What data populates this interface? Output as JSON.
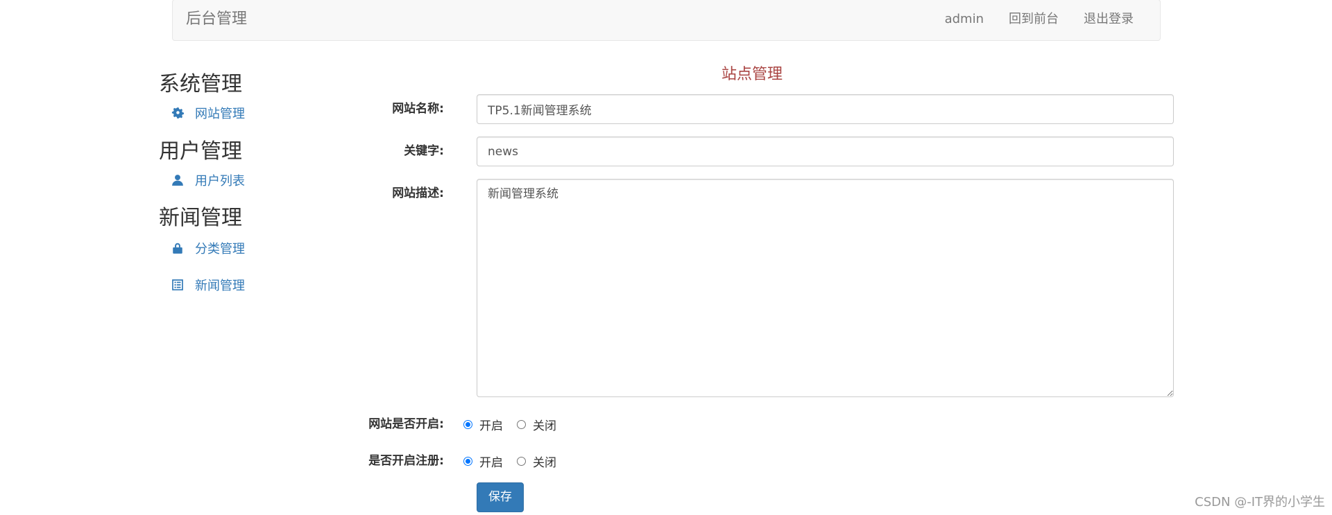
{
  "navbar": {
    "brand": "后台管理",
    "links": [
      "admin",
      "回到前台",
      "退出登录"
    ]
  },
  "sidebar": {
    "sections": [
      {
        "heading": "系统管理",
        "items": [
          {
            "label": "网站管理",
            "icon": "gear-icon"
          }
        ]
      },
      {
        "heading": "用户管理",
        "items": [
          {
            "label": "用户列表",
            "icon": "user-icon"
          }
        ]
      },
      {
        "heading": "新闻管理",
        "items": [
          {
            "label": "分类管理",
            "icon": "lock-icon"
          },
          {
            "label": "新闻管理",
            "icon": "list-icon"
          }
        ]
      }
    ]
  },
  "form": {
    "title": "站点管理",
    "site_name_label": "网站名称:",
    "site_name_value": "TP5.1新闻管理系统",
    "keywords_label": "关键字:",
    "keywords_value": "news",
    "description_label": "网站描述:",
    "description_value": "新闻管理系统",
    "site_open_label": "网站是否开启:",
    "site_open_options": [
      "开启",
      "关闭"
    ],
    "site_open_selected": "开启",
    "register_open_label": "是否开启注册:",
    "register_open_options": [
      "开启",
      "关闭"
    ],
    "register_open_selected": "开启",
    "save_label": "保存"
  },
  "watermark": "CSDN @-IT界的小学生",
  "colors": {
    "link": "#337ab7",
    "title": "#a94442",
    "radio_checked": "#0075ff",
    "button": "#337ab7"
  }
}
